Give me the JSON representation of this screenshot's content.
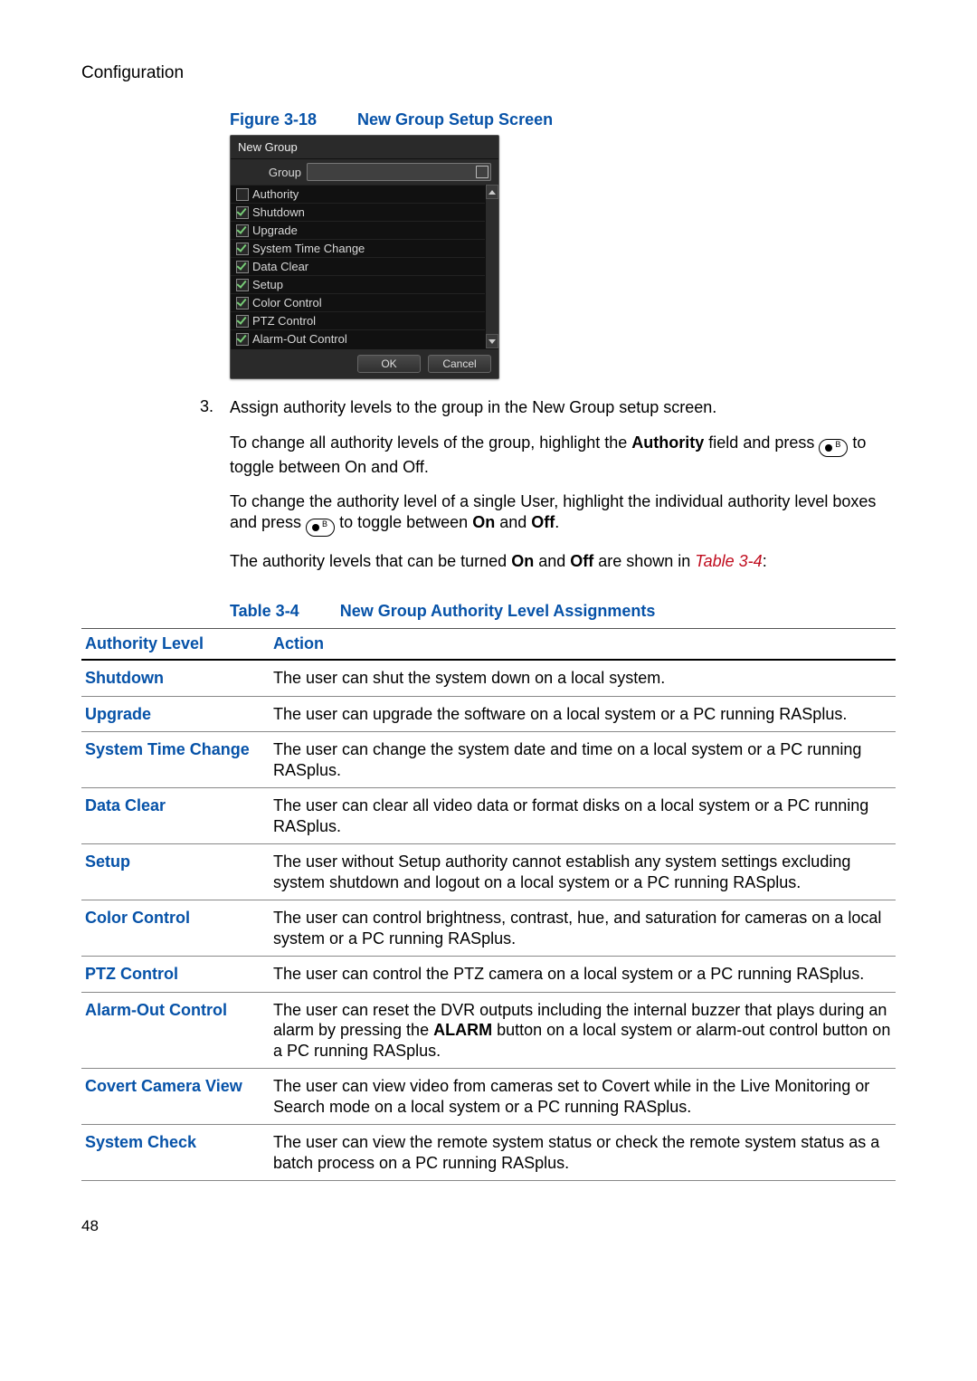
{
  "header": {
    "section": "Configuration"
  },
  "figure": {
    "number": "Figure 3-18",
    "title": "New Group Setup Screen"
  },
  "dialog": {
    "title": "New Group",
    "group_label": "Group",
    "group_value": "",
    "authority_label": "Authority",
    "items": [
      {
        "label": "Shutdown",
        "checked": true
      },
      {
        "label": "Upgrade",
        "checked": true
      },
      {
        "label": "System Time Change",
        "checked": true
      },
      {
        "label": "Data Clear",
        "checked": true
      },
      {
        "label": "Setup",
        "checked": true
      },
      {
        "label": "Color Control",
        "checked": true
      },
      {
        "label": "PTZ Control",
        "checked": true
      },
      {
        "label": "Alarm-Out Control",
        "checked": true
      }
    ],
    "ok_label": "OK",
    "cancel_label": "Cancel"
  },
  "step": {
    "number": "3.",
    "p1": "Assign authority levels to the group in the New Group setup screen.",
    "p2_a": "To change all authority levels of the group, highlight the ",
    "p2_b": "Authority",
    "p2_c": " field and press ",
    "p2_d": " to toggle between On and Off.",
    "p3_a": "To change the authority level of a single User, highlight the individual authority level boxes and press ",
    "p3_b": " to toggle between ",
    "p3_on": "On",
    "p3_and": " and ",
    "p3_off": "Off",
    "p3_end": ".",
    "p4_a": "The authority levels that can be turned ",
    "p4_on": "On",
    "p4_and": " and ",
    "p4_off": "Off",
    "p4_b": " are shown in ",
    "p4_ref": "Table 3-4",
    "p4_end": ":"
  },
  "table_caption": {
    "number": "Table 3-4",
    "title": "New Group Authority Level Assignments"
  },
  "table_headers": {
    "level": "Authority Level",
    "action": "Action"
  },
  "table_rows": [
    {
      "level": "Shutdown",
      "action": "The user can shut the system down on a local system."
    },
    {
      "level": "Upgrade",
      "action": "The user can upgrade the software on a local system or a PC running RASplus."
    },
    {
      "level": "System Time Change",
      "action": "The user can change the system date and time on a local system or a PC running RASplus."
    },
    {
      "level": "Data Clear",
      "action": "The user can clear all video data or format disks on a local system or a PC running RASplus."
    },
    {
      "level": "Setup",
      "action": "The user without Setup authority cannot establish any system settings excluding system shutdown and logout on a local system or a PC running RASplus."
    },
    {
      "level": "Color Control",
      "action": "The user can control brightness, contrast, hue, and saturation for cameras on a local system or a PC running RASplus."
    },
    {
      "level": "PTZ Control",
      "action": "The user can control the PTZ camera on a local system or a PC running RASplus."
    },
    {
      "level": "Alarm-Out Control",
      "action_a": "The user can reset the DVR outputs including the internal buzzer that plays during an alarm by pressing the ",
      "action_bold": "ALARM",
      "action_b": " button on a local system or alarm-out control button on a PC running RASplus."
    },
    {
      "level": "Covert Camera View",
      "action": "The user can view video from cameras set to Covert while in the Live Monitoring or Search mode on a local system or a PC running RASplus."
    },
    {
      "level": "System Check",
      "action": "The user can view the remote system status or check the remote system status as a batch process on a PC running RASplus."
    }
  ],
  "page_number": "48"
}
